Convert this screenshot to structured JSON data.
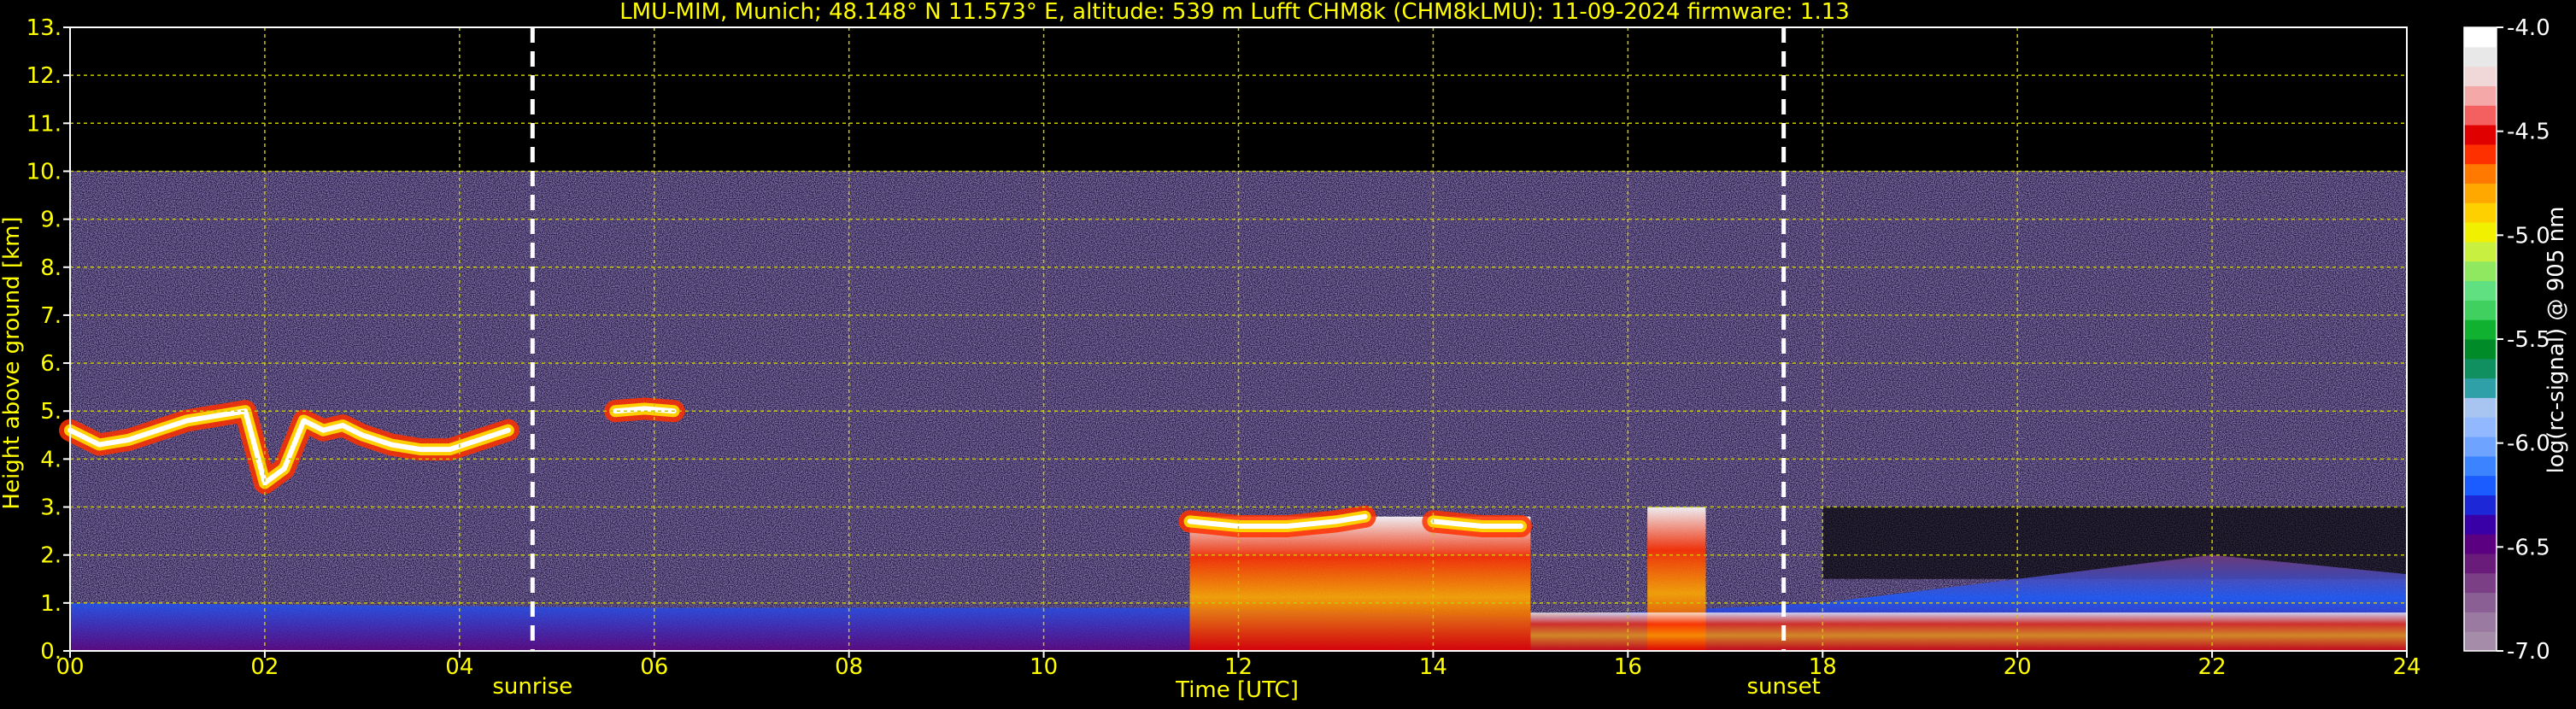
{
  "chart_data": {
    "type": "heatmap",
    "title": "LMU-MIM, Munich; 48.148° N 11.573° E, altitude: 539 m    Lufft CHM8k (CHM8kLMU): 11-09-2024    firmware: 1.13",
    "xlabel": "Time [UTC]",
    "ylabel": "Height above ground [km]",
    "xlim": [
      0,
      24
    ],
    "ylim": [
      0,
      13
    ],
    "x_ticks": [
      "00",
      "02",
      "04",
      "06",
      "08",
      "10",
      "12",
      "14",
      "16",
      "18",
      "20",
      "22",
      "24"
    ],
    "x_tick_values": [
      0,
      2,
      4,
      6,
      8,
      10,
      12,
      14,
      16,
      18,
      20,
      22,
      24
    ],
    "y_ticks": [
      "0.",
      "1.",
      "2.",
      "3.",
      "4.",
      "5.",
      "6.",
      "7.",
      "8.",
      "9.",
      "10.",
      "11.",
      "12.",
      "13."
    ],
    "y_tick_values": [
      0,
      1,
      2,
      3,
      4,
      5,
      6,
      7,
      8,
      9,
      10,
      11,
      12,
      13
    ],
    "grid": true,
    "colorbar": {
      "label": "log(rc-signal) @ 905 nm",
      "range": [
        -7.0,
        -4.0
      ],
      "ticks": [
        "-4.0",
        "-4.5",
        "-5.0",
        "-5.5",
        "-6.0",
        "-6.5",
        "-7.0"
      ],
      "tick_values": [
        -4.0,
        -4.5,
        -5.0,
        -5.5,
        -6.0,
        -6.5,
        -7.0
      ],
      "colors": [
        "#a58ca8",
        "#9a7aa0",
        "#8a5f94",
        "#7a3f85",
        "#6a1c7a",
        "#5a0080",
        "#3a00a8",
        "#1c28d8",
        "#1a5cff",
        "#3c84ff",
        "#6ea4ff",
        "#92b8ff",
        "#a8c4f0",
        "#30a0a8",
        "#109060",
        "#008a28",
        "#10b030",
        "#40d060",
        "#60e080",
        "#90e860",
        "#c8f040",
        "#f0f000",
        "#ffd000",
        "#ffa800",
        "#ff7800",
        "#ff3000",
        "#e00000",
        "#f46060",
        "#f4a8a8",
        "#f0d8d8",
        "#e8e8e8",
        "#ffffff"
      ]
    },
    "annotations": [
      {
        "label": "sunrise",
        "x": 4.75
      },
      {
        "label": "sunset",
        "x": 17.6
      }
    ],
    "signal_top_km": 10.0,
    "cloud_layers": [
      {
        "x": [
          0.0,
          0.3,
          0.6,
          0.9,
          1.2,
          1.5,
          1.8,
          2.0,
          2.2,
          2.4,
          2.6,
          2.8,
          3.0,
          3.3,
          3.6,
          3.9,
          4.2,
          4.5
        ],
        "y": [
          4.6,
          4.3,
          4.4,
          4.6,
          4.8,
          4.9,
          5.0,
          3.5,
          3.8,
          4.8,
          4.6,
          4.7,
          4.5,
          4.3,
          4.2,
          4.2,
          4.4,
          4.6
        ]
      },
      {
        "x": [
          5.6,
          5.9,
          6.2
        ],
        "y": [
          5.0,
          5.05,
          5.0
        ]
      },
      {
        "x": [
          11.5,
          12.0,
          12.5,
          13.0,
          13.3
        ],
        "y": [
          2.7,
          2.6,
          2.6,
          2.7,
          2.8
        ]
      },
      {
        "x": [
          14.0,
          14.5,
          14.9
        ],
        "y": [
          2.7,
          2.6,
          2.6
        ]
      }
    ],
    "aerosol_layer_top_km": [
      {
        "x": 0,
        "y": 1.0
      },
      {
        "x": 6,
        "y": 0.9
      },
      {
        "x": 11.5,
        "y": 0.9
      },
      {
        "x": 15,
        "y": 0.7
      },
      {
        "x": 18,
        "y": 1.0
      },
      {
        "x": 20,
        "y": 1.5
      },
      {
        "x": 22,
        "y": 2.0
      },
      {
        "x": 24,
        "y": 1.6
      }
    ]
  }
}
